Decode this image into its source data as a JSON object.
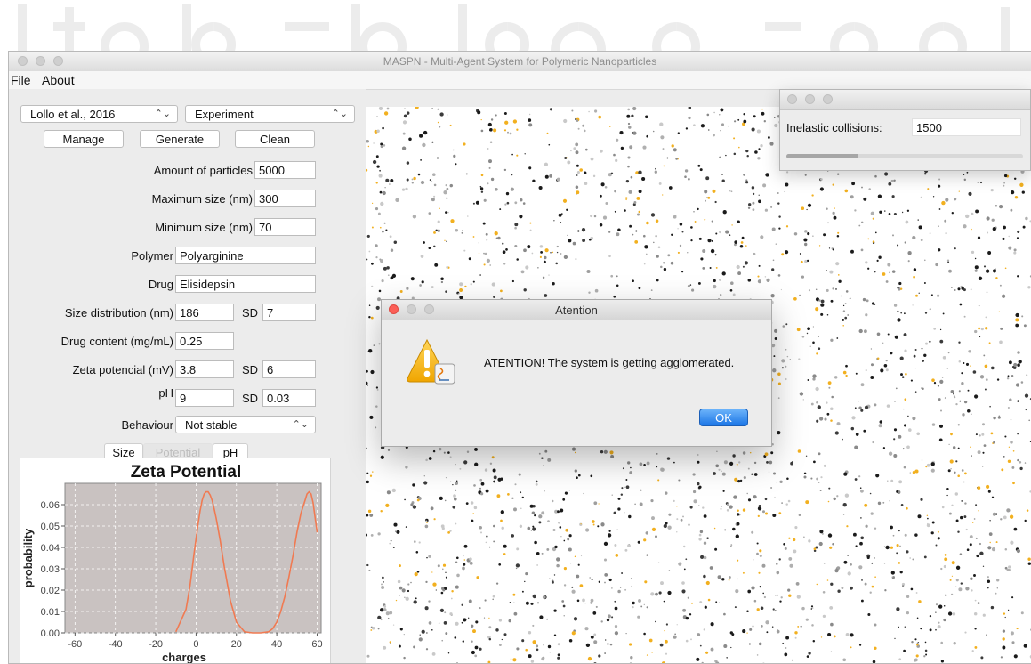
{
  "window": {
    "title": "MASPN - Multi-Agent System for Polymeric Nanoparticles"
  },
  "menu": {
    "file": "File",
    "about": "About"
  },
  "controls": {
    "reference_select": "Lollo et al., 2016",
    "mode_select": "Experiment",
    "manage_label": "Manage",
    "generate_label": "Generate",
    "clean_label": "Clean"
  },
  "form": {
    "amount_label": "Amount of particles",
    "amount_value": "5000",
    "max_size_label": "Maximum size (nm)",
    "max_size_value": "300",
    "min_size_label": "Minimum size (nm)",
    "min_size_value": "70",
    "polymer_label": "Polymer",
    "polymer_value": "Polyarginine",
    "drug_label": "Drug",
    "drug_value": "Elisidepsin",
    "size_dist_label": "Size distribution (nm)",
    "size_dist_value": "186",
    "size_sd_label": "SD",
    "size_sd_value": "7",
    "drug_content_label": "Drug content (mg/mL)",
    "drug_content_value": "0.25",
    "zeta_label": "Zeta potencial (mV)",
    "zeta_value": "3.8",
    "zeta_sd_label": "SD",
    "zeta_sd_value": "6",
    "ph_label": "pH",
    "ph_value": "9",
    "ph_sd_label": "SD",
    "ph_sd_value": "0.03",
    "behaviour_label": "Behaviour",
    "behaviour_value": "Not stable"
  },
  "tabs": [
    "Size",
    "Potential",
    "pH"
  ],
  "dialog": {
    "title": "Atention",
    "message": "ATENTION! The system is getting agglomerated.",
    "ok_label": "OK"
  },
  "collisions": {
    "label": "Inelastic collisions:",
    "value": "1500",
    "progress": 0.3
  },
  "colors": {
    "curve": "#f07a52",
    "accent": "#1c76e6",
    "plot_bg": "#c9c2c1"
  },
  "chart_data": {
    "type": "line",
    "title": "Zeta Potential",
    "xlabel": "charges",
    "ylabel": "probability",
    "xlim": [
      -65,
      62
    ],
    "ylim": [
      0,
      0.07
    ],
    "xticks": [
      "-60",
      "-40",
      "-20",
      "0",
      "20",
      "40",
      "60"
    ],
    "yticks": [
      "0.00",
      "0.01",
      "0.02",
      "0.03",
      "0.04",
      "0.05",
      "0.06"
    ],
    "grid": true,
    "series": [
      {
        "x": [
          -10,
          -5,
          -3,
          -1,
          0,
          1,
          2,
          3,
          4,
          5,
          6,
          7,
          8,
          9,
          10,
          12,
          14,
          17,
          20,
          24,
          28,
          32,
          36,
          38,
          40,
          42,
          44,
          46,
          48,
          50,
          52,
          54,
          55,
          56,
          57,
          58,
          59,
          60
        ],
        "y": [
          0.0005,
          0.011,
          0.022,
          0.037,
          0.044,
          0.051,
          0.057,
          0.062,
          0.065,
          0.066,
          0.066,
          0.0645,
          0.062,
          0.058,
          0.0535,
          0.043,
          0.031,
          0.015,
          0.005,
          0.0005,
          0.0,
          0.0,
          0.0005,
          0.002,
          0.005,
          0.01,
          0.017,
          0.026,
          0.036,
          0.047,
          0.056,
          0.062,
          0.065,
          0.066,
          0.065,
          0.061,
          0.054,
          0.047
        ]
      }
    ]
  }
}
